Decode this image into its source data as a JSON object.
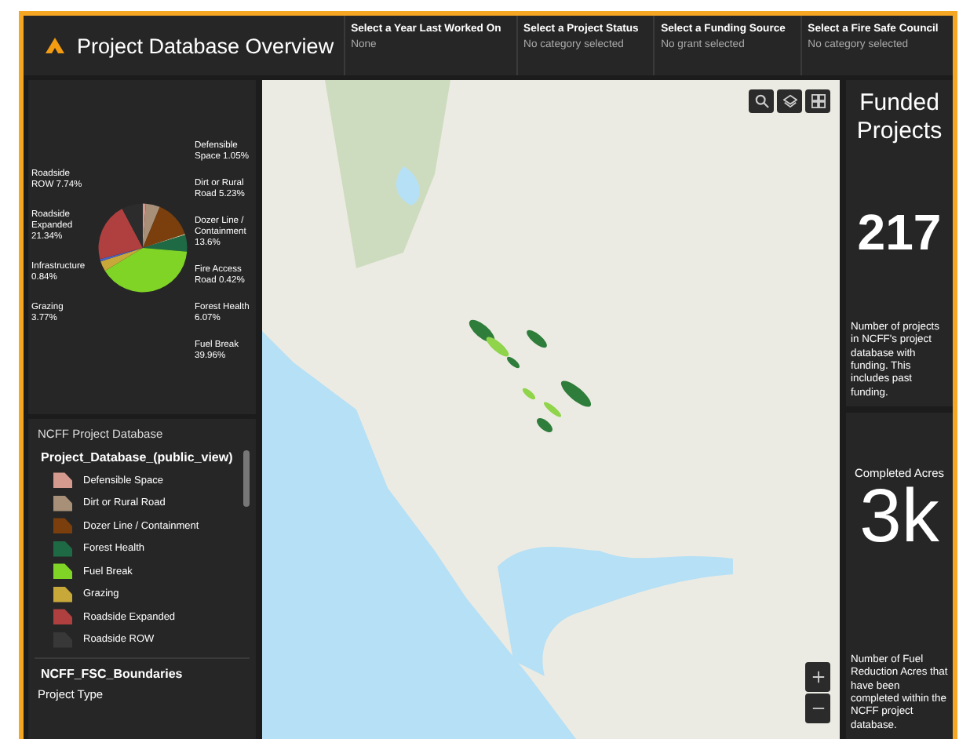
{
  "header": {
    "title": "Project Database Overview",
    "filters": [
      {
        "label": "Select a Year Last Worked On",
        "value": "None"
      },
      {
        "label": "Select a Project Status",
        "value": "No category selected"
      },
      {
        "label": "Select a Funding Source",
        "value": "No grant selected"
      },
      {
        "label": "Select a Fire Safe Council",
        "value": "No category selected"
      }
    ]
  },
  "pie": {
    "chart_data": {
      "type": "pie",
      "categories": [
        "Defensible Space",
        "Dirt or Rural Road",
        "Dozer Line / Containment",
        "Fire Access Road",
        "Forest Health",
        "Fuel Break",
        "Grazing",
        "Infrastructure",
        "Roadside Expanded",
        "Roadside ROW"
      ],
      "values": [
        1.05,
        5.23,
        13.6,
        0.42,
        6.07,
        39.96,
        3.77,
        0.84,
        21.34,
        7.74
      ],
      "colors": [
        "#d59a8e",
        "#a89078",
        "#7a3f0c",
        "#c9c9a0",
        "#1e6a45",
        "#7fd426",
        "#c9a83a",
        "#4a62c8",
        "#b0403f",
        "#2c2c2c"
      ],
      "value_labels": [
        "1.05%",
        "5.23%",
        "13.6%",
        "0.42%",
        "6.07%",
        "39.96%",
        "3.77%",
        "0.84%",
        "21.34%",
        "7.74%"
      ]
    }
  },
  "legend": {
    "title": "NCFF Project Database",
    "layers": [
      {
        "name": "Project_Database_(public_view)",
        "items": [
          {
            "label": "Defensible Space",
            "color": "#d59a8e"
          },
          {
            "label": "Dirt or Rural Road",
            "color": "#a89078"
          },
          {
            "label": "Dozer Line / Containment",
            "color": "#7a3f0c"
          },
          {
            "label": "Forest Health",
            "color": "#1e6a45"
          },
          {
            "label": "Fuel Break",
            "color": "#7fd426"
          },
          {
            "label": "Grazing",
            "color": "#c9a83a"
          },
          {
            "label": "Roadside Expanded",
            "color": "#b0403f"
          },
          {
            "label": "Roadside ROW",
            "color": "#383838"
          }
        ]
      },
      {
        "name": "NCFF_FSC_Boundaries",
        "subtitle": "Project Type"
      }
    ]
  },
  "stats": [
    {
      "kind": "featured",
      "title": "Funded Projects",
      "value": "217",
      "description": "Number of projects in NCFF's project database with funding. This includes past funding."
    },
    {
      "kind": "plain",
      "title": "Completed Acres",
      "value": "3k",
      "description": "Number of Fuel Reduction Acres that have been completed within the NCFF project database."
    }
  ]
}
